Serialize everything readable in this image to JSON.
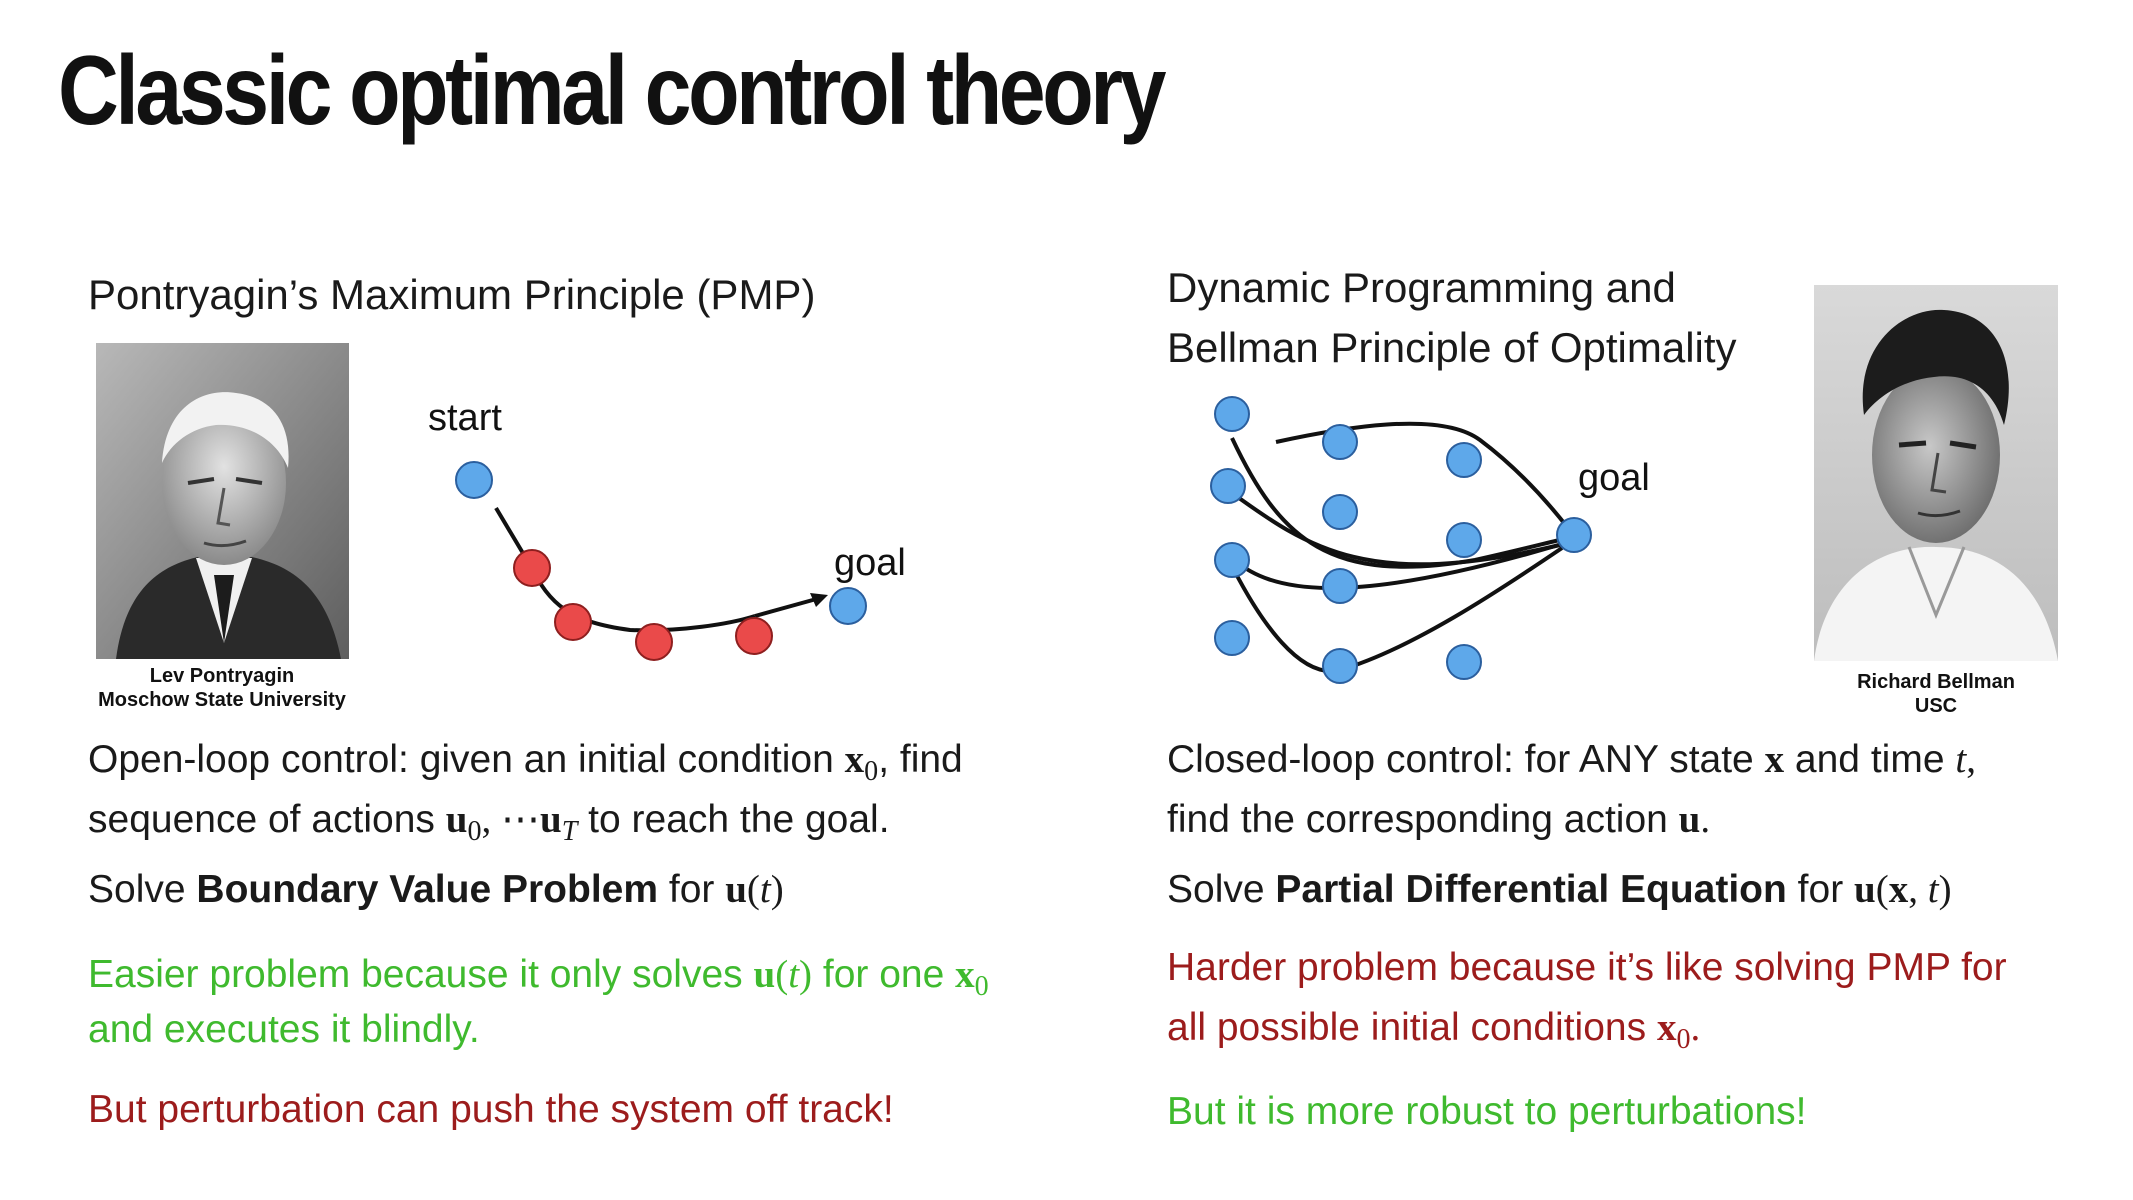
{
  "title": "Classic optimal control theory",
  "colors": {
    "node_blue": "#5ea8ea",
    "node_red": "#ea4a4a",
    "text_green": "#3fba2e",
    "text_red": "#9c1c1c"
  },
  "left": {
    "heading": "Pontryagin’s Maximum Principle (PMP)",
    "photo_caption_line1": "Lev Pontryagin",
    "photo_caption_line2": "Moschow State University",
    "diagram": {
      "start_label": "start",
      "goal_label": "goal"
    },
    "line1": {
      "a": "Open-loop control:  given an initial condition ",
      "x": "x",
      "sub0": "0",
      "b": ", find"
    },
    "line2": {
      "a": "sequence of actions ",
      "u": "u",
      "sub0": "0",
      "mid": ", ⋯",
      "u2": "u",
      "subT": "T",
      "b": " to reach the goal."
    },
    "line3": {
      "a": "Solve ",
      "bold": "Boundary Value Problem",
      "b": " for ",
      "u": "u",
      "po": "(",
      "t": "t",
      "pc": ")"
    },
    "green1": {
      "a": "Easier problem because it only solves ",
      "u": "u",
      "po": "(",
      "t": "t",
      "pc": ")",
      "b": " for one ",
      "x": "x",
      "sub0": "0"
    },
    "green2": "and executes it blindly.",
    "red": "But perturbation can push the system off track!"
  },
  "right": {
    "heading_line1": "Dynamic Programming and",
    "heading_line2": "Bellman Principle of Optimality",
    "photo_caption_line1": "Richard  Bellman",
    "photo_caption_line2": "USC",
    "diagram": {
      "goal_label": "goal"
    },
    "line1": {
      "a": "Closed-loop control:  for ANY state ",
      "x": "x",
      "b": " and time ",
      "t": "t",
      "c": ","
    },
    "line2": {
      "a": "find the corresponding action ",
      "u": "u",
      "b": "."
    },
    "line3": {
      "a": "Solve ",
      "bold": "Partial Differential Equation",
      "b": " for ",
      "u": "u",
      "po": "(",
      "x": "x",
      "comma": ", ",
      "t": "t",
      "pc": ")"
    },
    "red1": "Harder problem because it’s like solving PMP for",
    "red2": {
      "a": "all possible initial conditions ",
      "x": "x",
      "sub0": "0",
      "b": "."
    },
    "green": "But it is more robust to perturbations!"
  }
}
